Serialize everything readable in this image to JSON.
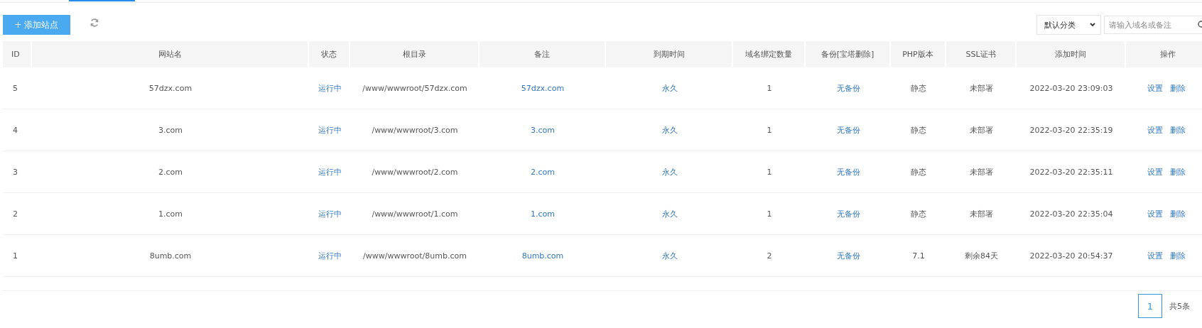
{
  "toolbar": {
    "add_button": "+ 添加站点",
    "category_select": "默认分类",
    "search": {
      "placeholder": "请输入域名或备注"
    }
  },
  "table": {
    "columns": [
      "ID",
      "网站名",
      "状态",
      "根目录",
      "备注",
      "到期时间",
      "域名绑定数量",
      "备份[宝塔删除]",
      "PHP版本",
      "SSL证书",
      "添加时间",
      "操作"
    ],
    "rows": [
      {
        "id": "5",
        "name": "57dzx.com",
        "status": "运行中",
        "root": "/www/wwwroot/57dzx.com",
        "note": "57dzx.com",
        "expiry": "永久",
        "domains": "1",
        "backup": "无备份",
        "php": "静态",
        "ssl": "未部署",
        "added": "2022-03-20 23:09:03",
        "actions": [
          "设置",
          "删除"
        ]
      },
      {
        "id": "4",
        "name": "3.com",
        "status": "运行中",
        "root": "/www/wwwroot/3.com",
        "note": "3.com",
        "expiry": "永久",
        "domains": "1",
        "backup": "无备份",
        "php": "静态",
        "ssl": "未部署",
        "added": "2022-03-20 22:35:19",
        "actions": [
          "设置",
          "删除"
        ]
      },
      {
        "id": "3",
        "name": "2.com",
        "status": "运行中",
        "root": "/www/wwwroot/2.com",
        "note": "2.com",
        "expiry": "永久",
        "domains": "1",
        "backup": "无备份",
        "php": "静态",
        "ssl": "未部署",
        "added": "2022-03-20 22:35:11",
        "actions": [
          "设置",
          "删除"
        ]
      },
      {
        "id": "2",
        "name": "1.com",
        "status": "运行中",
        "root": "/www/wwwroot/1.com",
        "note": "1.com",
        "expiry": "永久",
        "domains": "1",
        "backup": "无备份",
        "php": "静态",
        "ssl": "未部署",
        "added": "2022-03-20 22:35:04",
        "actions": [
          "设置",
          "删除"
        ]
      },
      {
        "id": "1",
        "name": "8umb.com",
        "status": "运行中",
        "root": "/www/wwwroot/8umb.com",
        "note": "8umb.com",
        "expiry": "永久",
        "domains": "2",
        "backup": "无备份",
        "php": "7.1",
        "ssl": "剩余84天",
        "added": "2022-03-20 20:54:37",
        "actions": [
          "设置",
          "删除"
        ]
      }
    ]
  },
  "pagination": {
    "pages": [
      {
        "label": "1",
        "selected": true
      }
    ],
    "total": "共5条"
  }
}
